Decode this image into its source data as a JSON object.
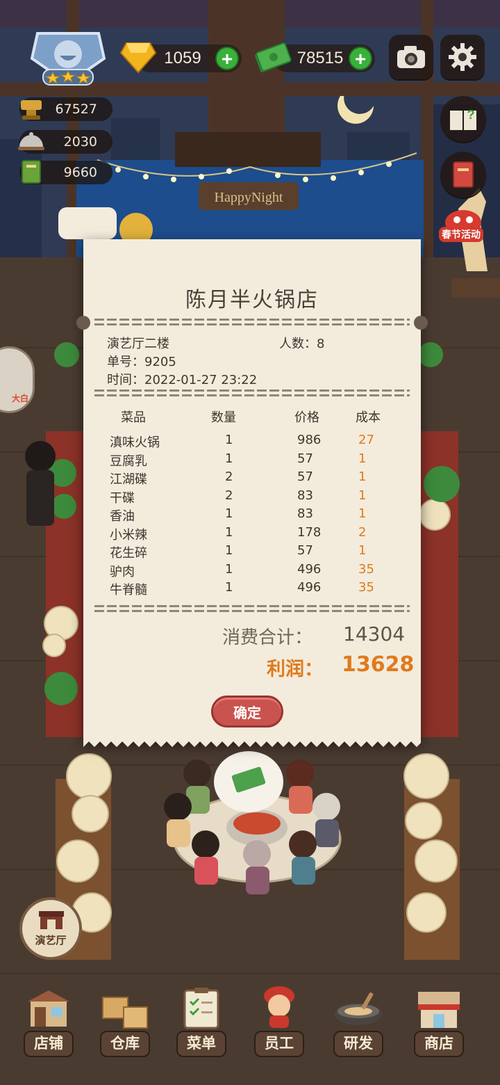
{
  "hud": {
    "gems": "1059",
    "cash": "78515",
    "stat1": "67527",
    "stat2": "2030",
    "stat3": "9660",
    "stars": 3
  },
  "icons": {
    "gem": "gem-icon",
    "cash": "cash-icon",
    "camera": "camera-icon",
    "settings": "gear-icon",
    "help_book": "help-book-icon",
    "recipe_book": "recipe-book-icon",
    "spring_event": "lion-dance-icon"
  },
  "sign_text": "HappyNight",
  "event_label": "春节活动",
  "receipt": {
    "title": "陈月半火锅店",
    "hall": "演艺厅二楼",
    "people": "人数：8",
    "order": "单号：9205",
    "time": "时间：2022-01-27 23:22",
    "headers": {
      "dish": "菜品",
      "qty": "数量",
      "price": "价格",
      "cost": "成本"
    },
    "items": [
      {
        "name": "滇味火锅",
        "qty": "1",
        "price": "986",
        "cost": "27"
      },
      {
        "name": "豆腐乳",
        "qty": "1",
        "price": "57",
        "cost": "1"
      },
      {
        "name": "江湖碟",
        "qty": "2",
        "price": "57",
        "cost": "1"
      },
      {
        "name": "干碟",
        "qty": "2",
        "price": "83",
        "cost": "1"
      },
      {
        "name": "香油",
        "qty": "1",
        "price": "83",
        "cost": "1"
      },
      {
        "name": "小米辣",
        "qty": "1",
        "price": "178",
        "cost": "2"
      },
      {
        "name": "花生碎",
        "qty": "1",
        "price": "57",
        "cost": "1"
      },
      {
        "name": "驴肉",
        "qty": "1",
        "price": "496",
        "cost": "35"
      },
      {
        "name": "牛脊髓",
        "qty": "1",
        "price": "496",
        "cost": "35"
      }
    ],
    "total_label": "消费合计：",
    "total_value": "14304",
    "profit_label": "利润：",
    "profit_value": "13628",
    "confirm": "确定"
  },
  "side": {
    "stage_label": "演艺厅",
    "left_badge": "大白"
  },
  "nav": [
    {
      "label": "店铺",
      "icon": "shop-icon"
    },
    {
      "label": "仓库",
      "icon": "warehouse-icon"
    },
    {
      "label": "菜单",
      "icon": "menu-clipboard-icon"
    },
    {
      "label": "员工",
      "icon": "staff-icon"
    },
    {
      "label": "研发",
      "icon": "research-wok-icon"
    },
    {
      "label": "商店",
      "icon": "store-icon"
    }
  ],
  "colors": {
    "accent_orange": "#e07a1c",
    "confirm_red": "#c9534f",
    "plus_green": "#3ab03a",
    "paper": "#f3ecdc"
  }
}
